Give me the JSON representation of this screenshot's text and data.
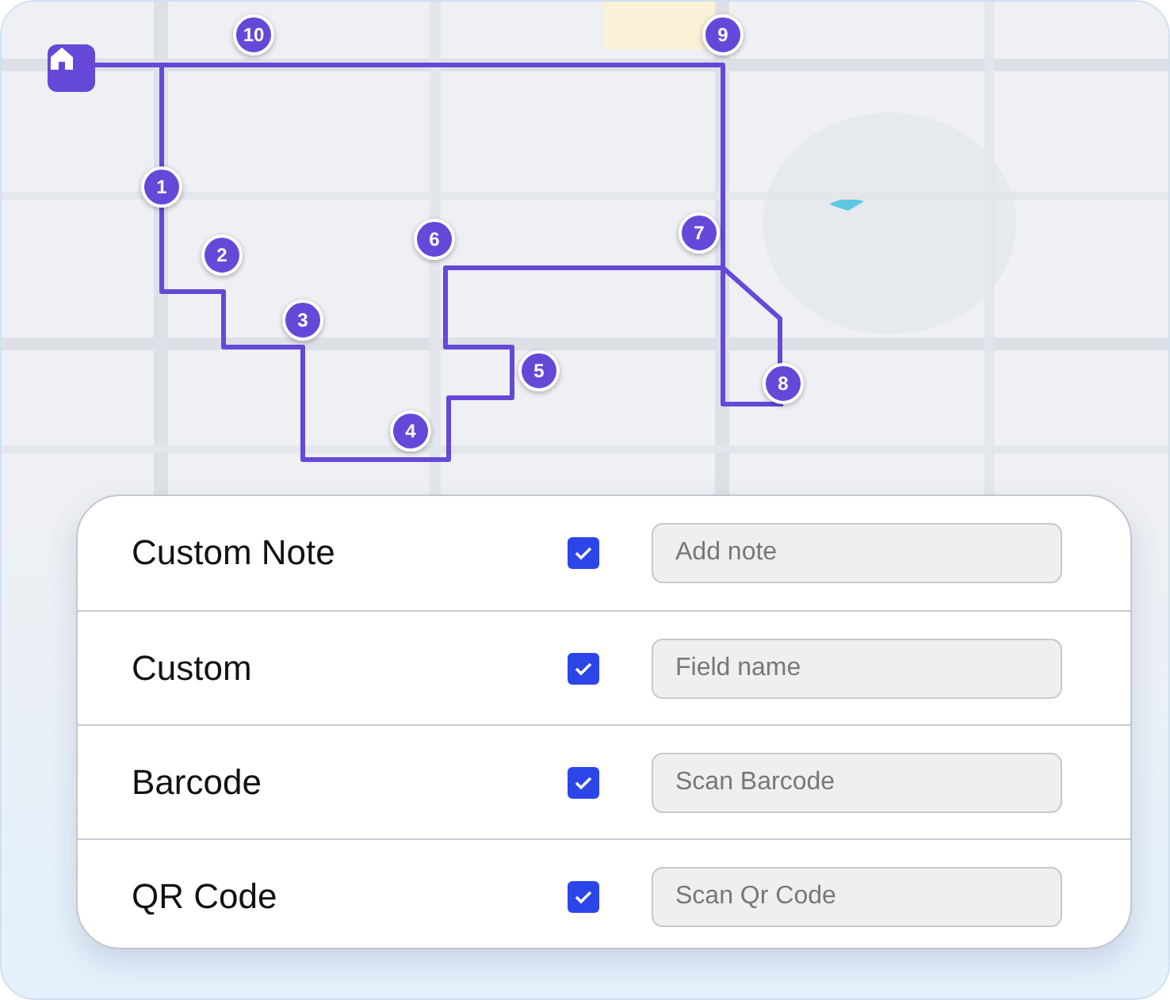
{
  "map": {
    "kind": "picture",
    "stops": [
      {
        "label": "10"
      },
      {
        "label": "9"
      },
      {
        "label": "1"
      },
      {
        "label": "2"
      },
      {
        "label": "3"
      },
      {
        "label": "4"
      },
      {
        "label": "5"
      },
      {
        "label": "6"
      },
      {
        "label": "7"
      },
      {
        "label": "8"
      }
    ]
  },
  "fields": [
    {
      "label": "Custom Note",
      "checked": true,
      "placeholder": "Add note"
    },
    {
      "label": "Custom",
      "checked": true,
      "placeholder": "Field name"
    },
    {
      "label": "Barcode",
      "checked": true,
      "placeholder": "Scan Barcode"
    },
    {
      "label": "QR Code",
      "checked": true,
      "placeholder": "Scan Qr Code"
    }
  ]
}
